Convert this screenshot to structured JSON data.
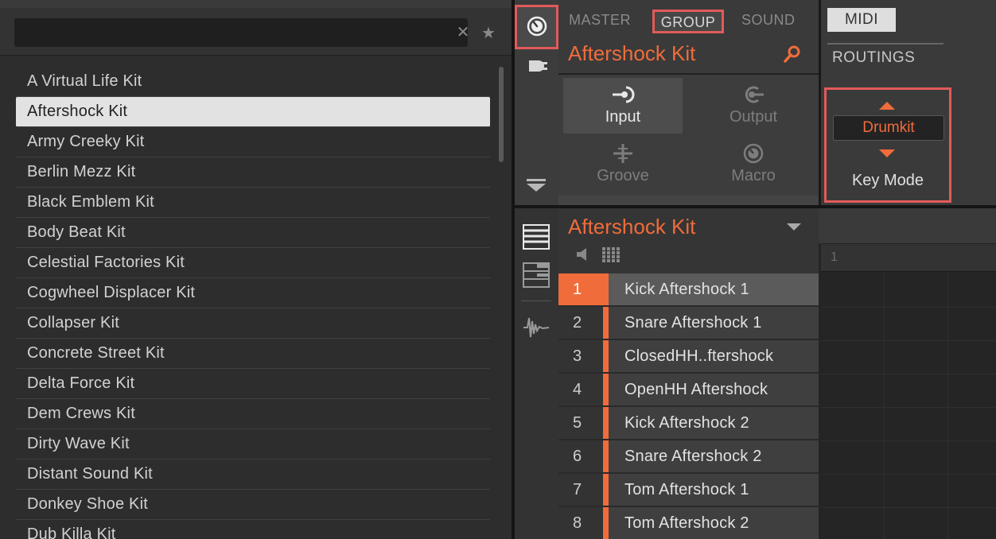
{
  "browser": {
    "search_value": "",
    "search_placeholder": "",
    "clear_symbol": "✕",
    "favorite_symbol": "★",
    "selected_index": 1,
    "items": [
      "A Virtual Life Kit",
      "Aftershock Kit",
      "Army Creeky Kit",
      "Berlin Mezz Kit",
      "Black Emblem Kit",
      "Body Beat Kit",
      "Celestial Factories Kit",
      "Cogwheel Displacer Kit",
      "Collapser Kit",
      "Concrete Street Kit",
      "Delta Force Kit",
      "Dem Crews Kit",
      "Dirty Wave Kit",
      "Distant Sound Kit",
      "Donkey Shoe Kit",
      "Dub Killa Kit"
    ]
  },
  "properties": {
    "tabs": {
      "master": "MASTER",
      "group": "GROUP",
      "sound": "SOUND"
    },
    "active_tab": "GROUP",
    "group_name": "Aftershock Kit",
    "modes": {
      "input": "Input",
      "output": "Output",
      "groove": "Groove",
      "macro": "Macro"
    },
    "active_mode": "Input"
  },
  "midi": {
    "tab": "MIDI",
    "section": "ROUTINGS",
    "key_mode_value": "Drumkit",
    "key_mode_label": "Key Mode"
  },
  "pads": {
    "group_name": "Aftershock Kit",
    "selected_index": 0,
    "items": [
      {
        "num": "1",
        "name": "Kick Aftershock 1"
      },
      {
        "num": "2",
        "name": "Snare Aftershock 1"
      },
      {
        "num": "3",
        "name": "ClosedHH..ftershock"
      },
      {
        "num": "4",
        "name": "OpenHH Aftershock"
      },
      {
        "num": "5",
        "name": "Kick Aftershock 2"
      },
      {
        "num": "6",
        "name": "Snare Aftershock 2"
      },
      {
        "num": "7",
        "name": "Tom Aftershock 1"
      },
      {
        "num": "8",
        "name": "Tom Aftershock 2"
      }
    ]
  },
  "arranger": {
    "ruler_label": "1"
  },
  "colors": {
    "accent": "#f06c3a",
    "highlight": "#e25a5a",
    "background": "#2d2d2d"
  },
  "icons": [
    "knob-icon",
    "plug-icon",
    "arrow-down-icon",
    "list-view-icon",
    "keyboard-view-icon",
    "waveform-icon",
    "search-icon",
    "input-icon",
    "output-icon",
    "groove-icon",
    "macro-icon",
    "dropdown-icon",
    "mute-icon",
    "grid-icon",
    "chevron-up-icon",
    "chevron-down-icon"
  ]
}
